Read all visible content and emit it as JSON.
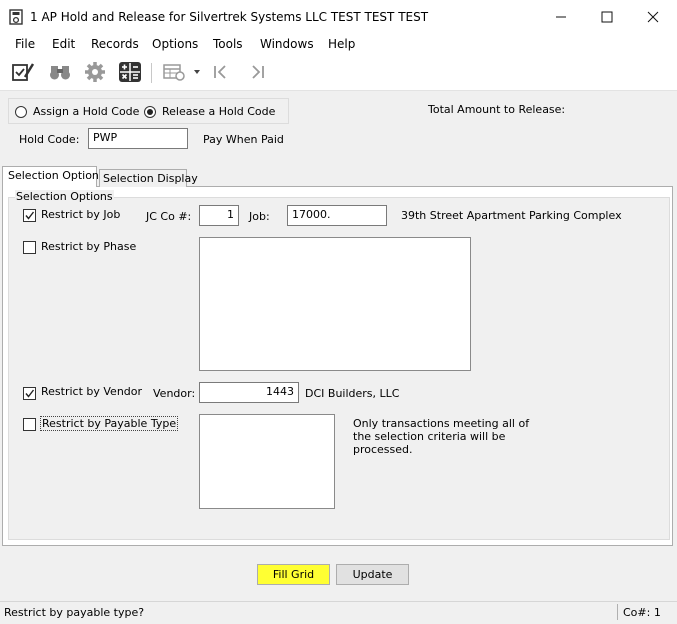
{
  "window": {
    "title": "1 AP Hold and Release for Silvertrek Systems LLC TEST TEST TEST",
    "minimize_icon": "minimize-icon",
    "maximize_icon": "maximize-icon",
    "close_icon": "close-icon"
  },
  "menu": [
    "File",
    "Edit",
    "Records",
    "Options",
    "Tools",
    "Windows",
    "Help"
  ],
  "toolbar": {
    "icons": [
      "checklist-pencil-icon",
      "binoculars-icon",
      "gear-icon",
      "calculator-icon",
      "grid-settings-icon",
      "dropdown-arrow-icon",
      "first-record-icon",
      "last-record-icon"
    ]
  },
  "hold_mode": {
    "assign_label": "Assign a  Hold Code",
    "release_label": "Release a Hold Code",
    "selected": "release"
  },
  "total_amount_label": "Total Amount to Release:",
  "hold_code": {
    "label": "Hold Code:",
    "value": "PWP",
    "description": "Pay When Paid"
  },
  "tabs": [
    "Selection Options",
    "Selection Display"
  ],
  "selection_options": {
    "group_title": "Selection Options",
    "restrict_job": {
      "label": "Restrict by Job",
      "checked": true,
      "jcco_label": "JC Co #:",
      "jcco_value": "1",
      "job_label": "Job:",
      "job_value": "17000.",
      "job_description": "39th Street Apartment Parking Complex"
    },
    "restrict_phase": {
      "label": "Restrict by Phase",
      "checked": false
    },
    "restrict_vendor": {
      "label": "Restrict by Vendor",
      "checked": true,
      "vendor_label": "Vendor:",
      "vendor_value": "1443",
      "vendor_name": "DCI Builders, LLC"
    },
    "restrict_payable_type": {
      "label": "Restrict by Payable Type",
      "checked": false
    },
    "note": "Only transactions meeting all of the selection criteria will be processed."
  },
  "buttons": {
    "fill_grid": "Fill Grid",
    "update": "Update",
    "highlight_color": "#ffff33"
  },
  "status": {
    "message": "Restrict by payable type?",
    "company": "Co#: 1"
  }
}
